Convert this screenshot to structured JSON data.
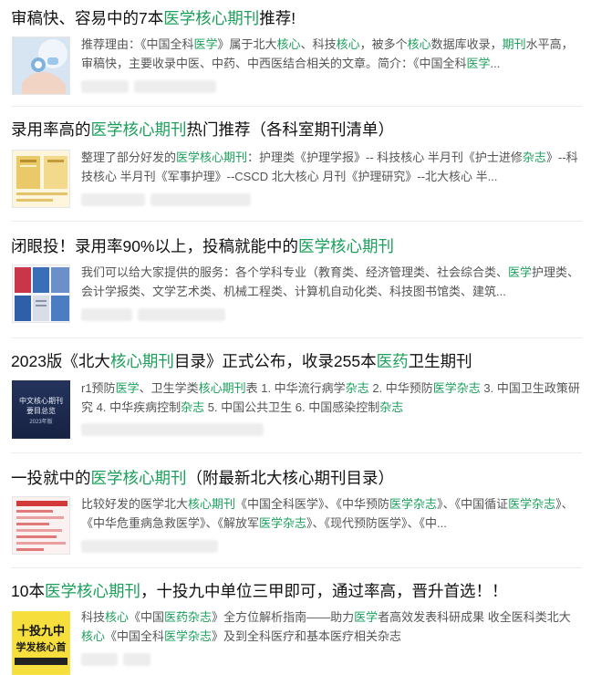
{
  "results": [
    {
      "title": [
        [
          "审稿快、容易中的7本",
          0
        ],
        [
          "医学核心期刊",
          1
        ],
        [
          "推荐!",
          0
        ]
      ],
      "desc": [
        [
          "推荐理由：《中国全科",
          0
        ],
        [
          "医学",
          1
        ],
        [
          "》属于北大",
          0
        ],
        [
          "核心",
          1
        ],
        [
          "、科技",
          0
        ],
        [
          "核心",
          1
        ],
        [
          "，被多个",
          0
        ],
        [
          "核心",
          1
        ],
        [
          "数据库收录，",
          0
        ],
        [
          "期刊",
          1
        ],
        [
          "水平高，审稿快，主要收录中医、中药、中西医结合相关的文章。简介：《中国全科",
          0
        ],
        [
          "医学",
          1
        ],
        [
          "...",
          0
        ]
      ],
      "thumb_icon": "medical-hand-icon"
    },
    {
      "title": [
        [
          "录用率高的",
          0
        ],
        [
          "医学核心期刊",
          1
        ],
        [
          "热门推荐（各科室期刊清单）",
          0
        ]
      ],
      "desc": [
        [
          "整理了部分好发的",
          0
        ],
        [
          "医学核心期刊",
          1
        ],
        [
          "：护理类《护理学报》-- 科技核心 半月刊《护士进修",
          0
        ],
        [
          "杂志",
          1
        ],
        [
          "》--科技核心 半月刊《军事护理》--CSCD 北大核心 月刊《护理研究》--北大核心 半...",
          0
        ]
      ],
      "thumb_icon": "journal-covers-icon"
    },
    {
      "title": [
        [
          "闭眼投！录用率90%以上，投稿就能中的",
          0
        ],
        [
          "医学核心期刊",
          1
        ]
      ],
      "desc": [
        [
          "我们可以给大家提供的服务：各个学科专业（教育类、经济管理类、社会综合类、",
          0
        ],
        [
          "医学",
          1
        ],
        [
          "护理类、会计学报类、文学艺术类、机械工程类、计算机自动化类、科技图书馆类、建筑...",
          0
        ]
      ],
      "thumb_icon": "journal-collage-icon"
    },
    {
      "title": [
        [
          "2023版《北大",
          0
        ],
        [
          "核心期刊",
          1
        ],
        [
          "目录》正式公布，收录255本",
          0
        ],
        [
          "医药",
          1
        ],
        [
          "卫生期刊",
          0
        ]
      ],
      "desc": [
        [
          "r1预防",
          0
        ],
        [
          "医学",
          1
        ],
        [
          "、卫生学类",
          0
        ],
        [
          "核心期刊",
          1
        ],
        [
          "表 1. 中华流行病学",
          0
        ],
        [
          "杂志",
          1
        ],
        [
          " 2. 中华预防",
          0
        ],
        [
          "医学杂志",
          1
        ],
        [
          " 3. 中国卫生政策研究 4. 中华疾病控制",
          0
        ],
        [
          "杂志",
          1
        ],
        [
          " 5. 中国公共卫生 6. 中国感染控制",
          0
        ],
        [
          "杂志",
          1
        ]
      ],
      "thumb_icon": "book-cover-icon",
      "thumb_text": [
        "中文核心期刊",
        "要目总览",
        "2023年版"
      ]
    },
    {
      "title": [
        [
          "一投就中的",
          0
        ],
        [
          "医学核心期刊",
          1
        ],
        [
          "（附最新北大核心期刊目录）",
          0
        ]
      ],
      "desc": [
        [
          "比较好发的医学北大",
          0
        ],
        [
          "核心期刊",
          1
        ],
        [
          "《中国全科医学》、《中华预防",
          0
        ],
        [
          "医学杂志",
          1
        ],
        [
          "》、《中国循证",
          0
        ],
        [
          "医学杂志",
          1
        ],
        [
          "》、《中华危重病急救医学》、《解放军",
          0
        ],
        [
          "医学杂志",
          1
        ],
        [
          "》、《现代预防医学》、《中...",
          0
        ]
      ],
      "thumb_icon": "journal-list-icon"
    },
    {
      "title": [
        [
          "10本",
          0
        ],
        [
          "医学核心期刊",
          1
        ],
        [
          "，十投九中单位三甲即可，通过率高，晋升首选！！",
          0
        ]
      ],
      "desc": [
        [
          "科技",
          0
        ],
        [
          "核心",
          1
        ],
        [
          "《中国",
          0
        ],
        [
          "医药杂志",
          1
        ],
        [
          "》全方位解析指南——助力",
          0
        ],
        [
          "医学",
          1
        ],
        [
          "者高效发表科研成果 收全医科类北大",
          0
        ],
        [
          "核心",
          1
        ],
        [
          "《中国全科",
          0
        ],
        [
          "医学杂志",
          1
        ],
        [
          "》及到全科医疗和基本医疗相关杂志",
          0
        ]
      ],
      "thumb_icon": "promo-banner-icon",
      "thumb_text": [
        "十投九中",
        "学发核心首"
      ]
    }
  ]
}
